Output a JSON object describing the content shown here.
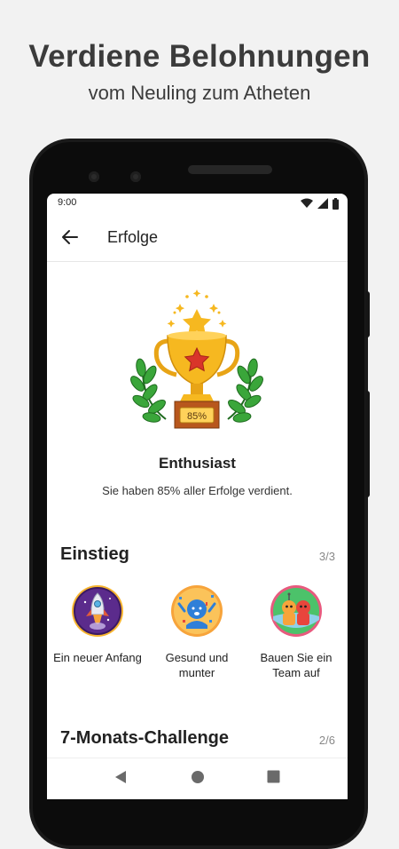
{
  "promo": {
    "title": "Verdiene Belohnungen",
    "subtitle": "vom Neuling zum Atheten"
  },
  "status_bar": {
    "time": "9:00",
    "icons": [
      "wifi-icon",
      "signal-icon",
      "battery-icon"
    ]
  },
  "app_bar": {
    "back_icon": "arrow-left-icon",
    "title": "Erfolge"
  },
  "hero": {
    "trophy_percent": "85%",
    "title": "Enthusiast",
    "description": "Sie haben 85% aller Erfolge verdient."
  },
  "sections": [
    {
      "title": "Einstieg",
      "count": "3/3",
      "badges": [
        {
          "label": "Ein neuer Anfang",
          "icon": "rocket-icon"
        },
        {
          "label": "Gesund und munter",
          "icon": "celebration-icon"
        },
        {
          "label": "Bauen Sie ein Team auf",
          "icon": "team-icon"
        }
      ]
    },
    {
      "title": "7-Monats-Challenge",
      "count": "2/6"
    }
  ],
  "nav_bar": {
    "buttons": [
      "back-triangle-icon",
      "home-circle-icon",
      "recents-square-icon"
    ]
  },
  "colors": {
    "background": "#f2f2f2",
    "heading": "#3b3b3b",
    "trophy_gold": "#f6b820",
    "laurel_green": "#3aa63a",
    "badge_purple": "#5b2b8c",
    "badge_orange": "#f7a43b",
    "badge_green": "#4cc26a"
  }
}
